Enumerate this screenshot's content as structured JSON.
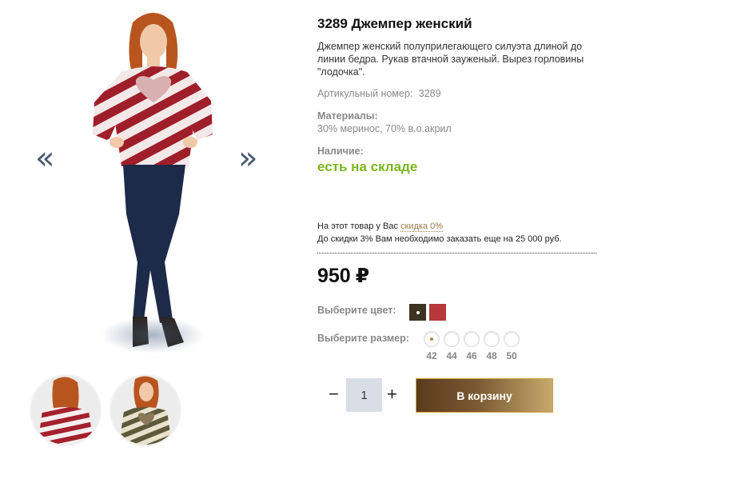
{
  "gallery": {
    "prev_arrow": "«",
    "next_arrow": "»",
    "main_image": "woman-red-white-striped-sweater",
    "thumbnails": [
      "back-view-red-striped-sweater",
      "olive-striped-sweater"
    ]
  },
  "product": {
    "title": "3289 Джемпер женский",
    "description": "Джемпер женский полуприлегающего силуэта длиной до линии бедра. Рукав втачной зауженый. Вырез горловины \"лодочка\".",
    "sku_label": "Артикульный номер:",
    "sku_value": "3289",
    "materials_label": "Материалы:",
    "materials_value": "30% меринос, 70% в.о.акрил",
    "stock_label": "Наличие:",
    "stock_value": "есть на складе",
    "stock_color": "#7ab51d"
  },
  "discount": {
    "line1_prefix": "На этот товар у Вас",
    "line1_link": "скидка 0%",
    "line2": "До скидки 3% Вам необходимо заказать еще на 25 000 руб."
  },
  "price": {
    "value": "950",
    "currency": "₽"
  },
  "options": {
    "color_label": "Выберите цвет:",
    "colors": [
      "#3a3420",
      "#b43a3a"
    ],
    "selected_color": "#3a3420",
    "size_label": "Выберите размер:",
    "sizes": [
      "42",
      "44",
      "46",
      "48",
      "50"
    ],
    "selected_size": "42"
  },
  "cart": {
    "minus": "−",
    "plus": "+",
    "quantity": "1",
    "button_label": "В корзину",
    "button_gradient": [
      "#5a3b1c",
      "#c8a96c"
    ]
  }
}
